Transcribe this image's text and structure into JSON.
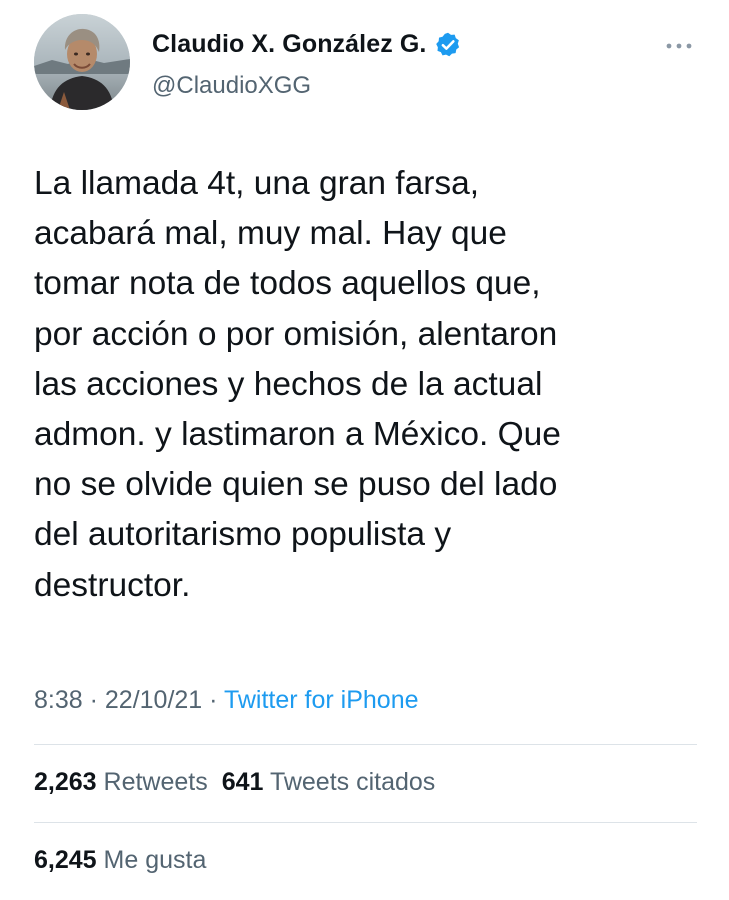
{
  "user": {
    "display_name": "Claudio X. González G.",
    "handle": "@ClaudioXGG",
    "verified_icon": "verified-badge-icon",
    "avatar_icon": "profile-photo"
  },
  "more_icon": "more-options-icon",
  "tweet": {
    "text": "La llamada 4t, una gran farsa,\nacabará mal, muy mal. Hay que\ntomar nota de todos aquellos que,\npor acción o por omisión, alentaron\nlas acciones y hechos de la actual\nadmon. y lastimaron a México. Que\nno se olvide quien se puso del lado\ndel autoritarismo populista y\ndestructor."
  },
  "meta": {
    "time": "8:38",
    "separator1": " · ",
    "date": "22/10/21",
    "separator2": " · ",
    "source": "Twitter for iPhone"
  },
  "stats": {
    "retweets_count": "2,263",
    "retweets_label": "Retweets",
    "quotes_count": "641",
    "quotes_label": "Tweets citados",
    "likes_count": "6,245",
    "likes_label": "Me gusta"
  },
  "colors": {
    "text": "#0f1419",
    "secondary": "#536471",
    "link": "#1d9bf0",
    "divider": "#dde3e8"
  }
}
